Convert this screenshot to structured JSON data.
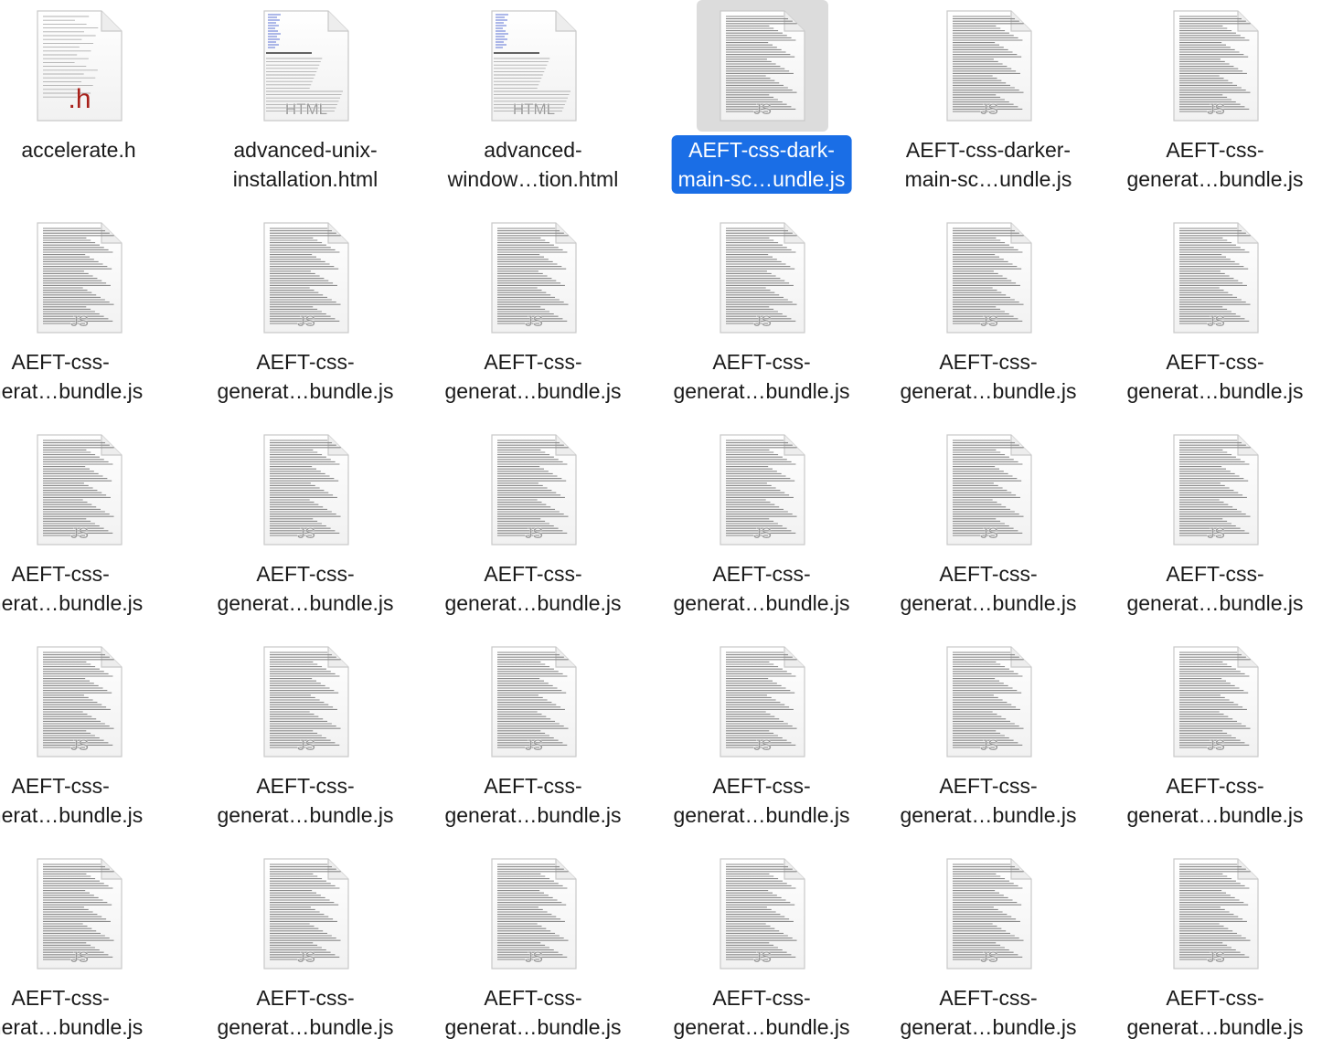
{
  "files": [
    {
      "name_line1": "accelerate.h",
      "name_line2": "",
      "type": "h-header-doc-icon",
      "badge": ".h",
      "selected": false
    },
    {
      "name_line1": "advanced-unix-",
      "name_line2": "installation.html",
      "type": "html-doc-icon",
      "badge": "HTML",
      "selected": false
    },
    {
      "name_line1": "advanced-",
      "name_line2": "window…tion.html",
      "type": "html-doc-icon",
      "badge": "HTML",
      "selected": false
    },
    {
      "name_line1": "AEFT-css-dark-",
      "name_line2": "main-sc…undle.js",
      "type": "js-doc-icon",
      "badge": "JS",
      "selected": true
    },
    {
      "name_line1": "AEFT-css-darker-",
      "name_line2": "main-sc…undle.js",
      "type": "js-doc-icon",
      "badge": "JS",
      "selected": false
    },
    {
      "name_line1": "AEFT-css-",
      "name_line2": "generat…bundle.js",
      "type": "js-doc-icon",
      "badge": "JS",
      "selected": false
    },
    {
      "name_line1": "AEFT-css-",
      "name_line2": "enerat…bundle.js",
      "type": "js-doc-icon",
      "badge": "JS",
      "selected": false
    },
    {
      "name_line1": "AEFT-css-",
      "name_line2": "generat…bundle.js",
      "type": "js-doc-icon",
      "badge": "JS",
      "selected": false
    },
    {
      "name_line1": "AEFT-css-",
      "name_line2": "generat…bundle.js",
      "type": "js-doc-icon",
      "badge": "JS",
      "selected": false
    },
    {
      "name_line1": "AEFT-css-",
      "name_line2": "generat…bundle.js",
      "type": "js-doc-icon",
      "badge": "JS",
      "selected": false
    },
    {
      "name_line1": "AEFT-css-",
      "name_line2": "generat…bundle.js",
      "type": "js-doc-icon",
      "badge": "JS",
      "selected": false
    },
    {
      "name_line1": "AEFT-css-",
      "name_line2": "generat…bundle.js",
      "type": "js-doc-icon",
      "badge": "JS",
      "selected": false
    },
    {
      "name_line1": "AEFT-css-",
      "name_line2": "enerat…bundle.js",
      "type": "js-doc-icon",
      "badge": "JS",
      "selected": false
    },
    {
      "name_line1": "AEFT-css-",
      "name_line2": "generat…bundle.js",
      "type": "js-doc-icon",
      "badge": "JS",
      "selected": false
    },
    {
      "name_line1": "AEFT-css-",
      "name_line2": "generat…bundle.js",
      "type": "js-doc-icon",
      "badge": "JS",
      "selected": false
    },
    {
      "name_line1": "AEFT-css-",
      "name_line2": "generat…bundle.js",
      "type": "js-doc-icon",
      "badge": "JS",
      "selected": false
    },
    {
      "name_line1": "AEFT-css-",
      "name_line2": "generat…bundle.js",
      "type": "js-doc-icon",
      "badge": "JS",
      "selected": false
    },
    {
      "name_line1": "AEFT-css-",
      "name_line2": "generat…bundle.js",
      "type": "js-doc-icon",
      "badge": "JS",
      "selected": false
    },
    {
      "name_line1": "AEFT-css-",
      "name_line2": "enerat…bundle.js",
      "type": "js-doc-icon",
      "badge": "JS",
      "selected": false
    },
    {
      "name_line1": "AEFT-css-",
      "name_line2": "generat…bundle.js",
      "type": "js-doc-icon",
      "badge": "JS",
      "selected": false
    },
    {
      "name_line1": "AEFT-css-",
      "name_line2": "generat…bundle.js",
      "type": "js-doc-icon",
      "badge": "JS",
      "selected": false
    },
    {
      "name_line1": "AEFT-css-",
      "name_line2": "generat…bundle.js",
      "type": "js-doc-icon",
      "badge": "JS",
      "selected": false
    },
    {
      "name_line1": "AEFT-css-",
      "name_line2": "generat…bundle.js",
      "type": "js-doc-icon",
      "badge": "JS",
      "selected": false
    },
    {
      "name_line1": "AEFT-css-",
      "name_line2": "generat…bundle.js",
      "type": "js-doc-icon",
      "badge": "JS",
      "selected": false
    },
    {
      "name_line1": "AEFT-css-",
      "name_line2": "enerat…bundle.js",
      "type": "js-doc-icon",
      "badge": "JS",
      "selected": false
    },
    {
      "name_line1": "AEFT-css-",
      "name_line2": "generat…bundle.js",
      "type": "js-doc-icon",
      "badge": "JS",
      "selected": false
    },
    {
      "name_line1": "AEFT-css-",
      "name_line2": "generat…bundle.js",
      "type": "js-doc-icon",
      "badge": "JS",
      "selected": false
    },
    {
      "name_line1": "AEFT-css-",
      "name_line2": "generat…bundle.js",
      "type": "js-doc-icon",
      "badge": "JS",
      "selected": false
    },
    {
      "name_line1": "AEFT-css-",
      "name_line2": "generat…bundle.js",
      "type": "js-doc-icon",
      "badge": "JS",
      "selected": false
    },
    {
      "name_line1": "AEFT-css-",
      "name_line2": "generat…bundle.js",
      "type": "js-doc-icon",
      "badge": "JS",
      "selected": false
    }
  ],
  "colors": {
    "selection_label_bg": "#1a6ee6",
    "selection_icon_bg": "#dcdcdc",
    "header_badge": "#a8201a",
    "html_badge": "#9a9a9a",
    "js_badge": "#9a9a9a"
  }
}
